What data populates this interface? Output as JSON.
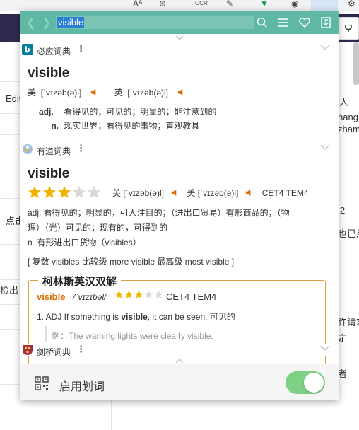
{
  "background": {
    "toolbar_glyphs": [
      "Aᴬ",
      "⊕",
      "OCR",
      "✎",
      "▼",
      "◉",
      "⚙"
    ],
    "header_button_icon": "fork-icon",
    "left_texts": [
      "Edit",
      "点击",
      "检出"
    ],
    "right_texts": [
      "人",
      "nang",
      "zham",
      "2",
      "也已用",
      "许请求",
      "定",
      "者"
    ]
  },
  "popup": {
    "search": {
      "value": "visible"
    },
    "header_icons": [
      "search-icon",
      "menu-icon",
      "heart-icon",
      "book-icon"
    ],
    "bing": {
      "name": "必应词典",
      "word": "visible",
      "us_label": "美:",
      "us_phonetic": "[ˈvɪzəb(ə)l]",
      "uk_label": "英:",
      "uk_phonetic": "[ˈvɪzəb(ə)l]",
      "defs": [
        {
          "pos": "adj.",
          "text": "看得见的；可见的；明显的；能注意到的"
        },
        {
          "pos": "n.",
          "text": "现实世界；看得见的事物；直观教具"
        }
      ]
    },
    "youdao": {
      "name": "有道词典",
      "word": "visible",
      "stars": 3,
      "stars_total": 5,
      "uk_label": "英",
      "uk_phonetic": "[ˈvɪzəb(ə)l]",
      "us_label": "美",
      "us_phonetic": "[ˈvɪzəb(ə)l]",
      "tags": "CET4 TEM4",
      "def_adj_line1": "adj. 看得见的；明显的，引人注目的；（进出口贸易）有形商品的；（物",
      "def_adj_line2": "理）（光）可见的；现有的，可得到的",
      "def_n": "n. 有形进出口货物（visibles）",
      "forms": "[ 复数 visibles 比较级 more visible 最高级 most visible ]"
    },
    "collins": {
      "title": "柯林斯英汉双解",
      "word": "visible",
      "phonetic": "/ˈvɪzɪbəl/",
      "stars": 3,
      "stars_total": 5,
      "tags": "CET4 TEM4",
      "def_prefix": "1. ADJ If something is ",
      "def_bold": "visible",
      "def_suffix": ", it can be seen. 可见的",
      "example_label": "例：",
      "example": "The warning lights were clearly visible."
    },
    "cambridge": {
      "name": "剑桥词典"
    },
    "footer": {
      "label": "启用划词",
      "toggle_on": true
    }
  },
  "colors": {
    "header": "#5fb8a3",
    "accent_orange": "#e06c00",
    "star_on": "#f0b400",
    "star_off": "#d8d8d8",
    "toggle_on": "#7ed085"
  }
}
